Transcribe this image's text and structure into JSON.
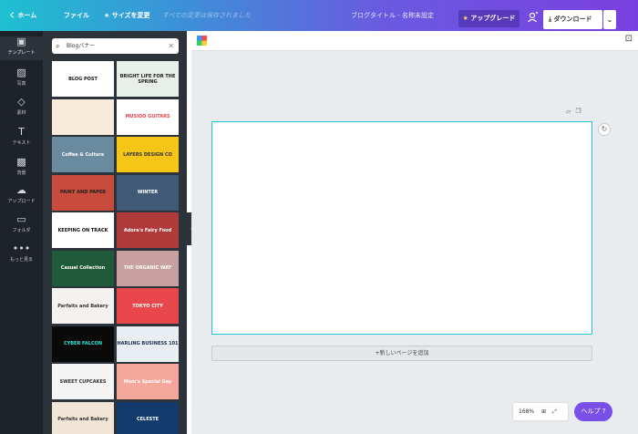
{
  "topbar": {
    "home": "く ホーム",
    "file": "ファイル",
    "resize": "サイズを変更",
    "save_status": "すべての変更は保存されました",
    "doc_title": "ブログタイトル - 名称未設定",
    "upgrade": "アップグレード",
    "download": "ダウンロード"
  },
  "rail": {
    "items": [
      {
        "label": "テンプレート",
        "icon": "▣"
      },
      {
        "label": "写真",
        "icon": "▨"
      },
      {
        "label": "素材",
        "icon": "◇"
      },
      {
        "label": "テキスト",
        "icon": "T"
      },
      {
        "label": "背景",
        "icon": "▩"
      },
      {
        "label": "アップロード",
        "icon": "☁"
      },
      {
        "label": "フォルダ",
        "icon": "▭"
      },
      {
        "label": "もっと見る",
        "icon": "•••"
      }
    ]
  },
  "search": {
    "value": "Blogバナー"
  },
  "thumbnails": [
    {
      "text": "BLOG POST",
      "bg": "#ffffff",
      "fg": "#111111"
    },
    {
      "text": "BRIGHT LIFE FOR THE SPRING",
      "bg": "#e8eee8",
      "fg": "#222222"
    },
    {
      "text": "",
      "bg": "#f8ebd9",
      "fg": "#b28a67"
    },
    {
      "text": "MUSIOO GUITARS",
      "bg": "#ffffff",
      "fg": "#e8474c"
    },
    {
      "text": "Coffee & Culture",
      "bg": "#6a8aa0",
      "fg": "#ffffff"
    },
    {
      "text": "LAYERS DESIGN CO",
      "bg": "#f5c518",
      "fg": "#333333"
    },
    {
      "text": "PAINT AND PAPER",
      "bg": "#c84b3c",
      "fg": "#222222"
    },
    {
      "text": "WINTER",
      "bg": "#415a77",
      "fg": "#ffffff"
    },
    {
      "text": "KEEPING ON TRACK",
      "bg": "#ffffff",
      "fg": "#111111"
    },
    {
      "text": "Adora's Fairy Food",
      "bg": "#b03a3a",
      "fg": "#ffffff"
    },
    {
      "text": "Casual Collection",
      "bg": "#1f5a3a",
      "fg": "#ffffff"
    },
    {
      "text": "THE ORGANIC WAY",
      "bg": "#c9a0a0",
      "fg": "#ffffff"
    },
    {
      "text": "Parfaits and Bakery",
      "bg": "#f4f1ee",
      "fg": "#333333"
    },
    {
      "text": "TOKYO CITY",
      "bg": "#e8474c",
      "fg": "#ffffff"
    },
    {
      "text": "CYBER FALCON",
      "bg": "#0a0a0a",
      "fg": "#2ee6d6"
    },
    {
      "text": "HARLING BUSINESS 101",
      "bg": "#e9eef3",
      "fg": "#1c2e4a"
    },
    {
      "text": "SWEET CUPCAKES",
      "bg": "#f4f4f4",
      "fg": "#333333"
    },
    {
      "text": "Mom's Special Day",
      "bg": "#f4a79a",
      "fg": "#ffffff"
    },
    {
      "text": "Parfaits and Bakery",
      "bg": "#f1e6d6",
      "fg": "#333333"
    },
    {
      "text": "CELESTE",
      "bg": "#123a6b",
      "fg": "#ffffff"
    }
  ],
  "canvas": {
    "add_page": "+新しいページを追加",
    "zoom": "168%",
    "help": "ヘルプ ?"
  }
}
